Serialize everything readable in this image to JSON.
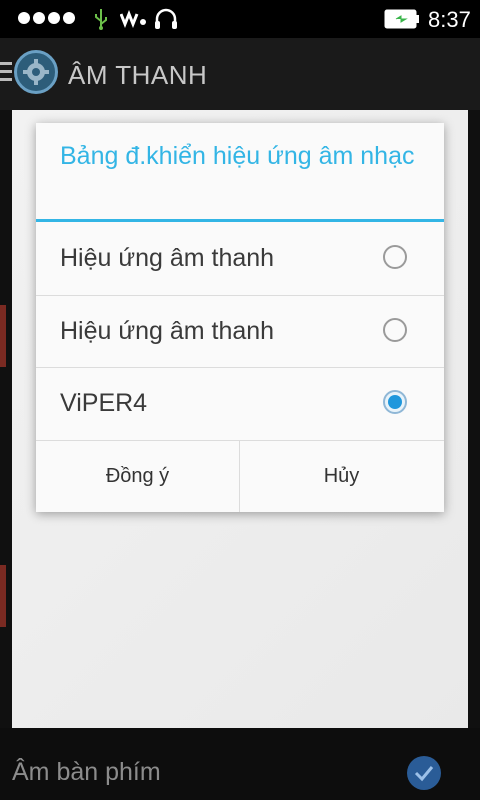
{
  "status_bar": {
    "time": "8:37",
    "icons": [
      "signal-dots-icon",
      "usb-icon",
      "walkman-icon",
      "headphones-icon",
      "battery-charging-icon"
    ]
  },
  "action_bar": {
    "title": "ÂM THANH",
    "icon": "gear-icon"
  },
  "background_setting": {
    "label": "Âm bàn phím",
    "checked": true
  },
  "dialog": {
    "title": "Bảng đ.khiển hiệu ứng âm nhạc",
    "accent_color": "#33b5e5",
    "options": [
      {
        "label": "Hiệu ứng âm thanh",
        "selected": false
      },
      {
        "label": "Hiệu ứng âm thanh",
        "selected": false
      },
      {
        "label": "ViPER4",
        "selected": true
      }
    ],
    "buttons": {
      "ok": "Đồng ý",
      "cancel": "Hủy"
    }
  }
}
